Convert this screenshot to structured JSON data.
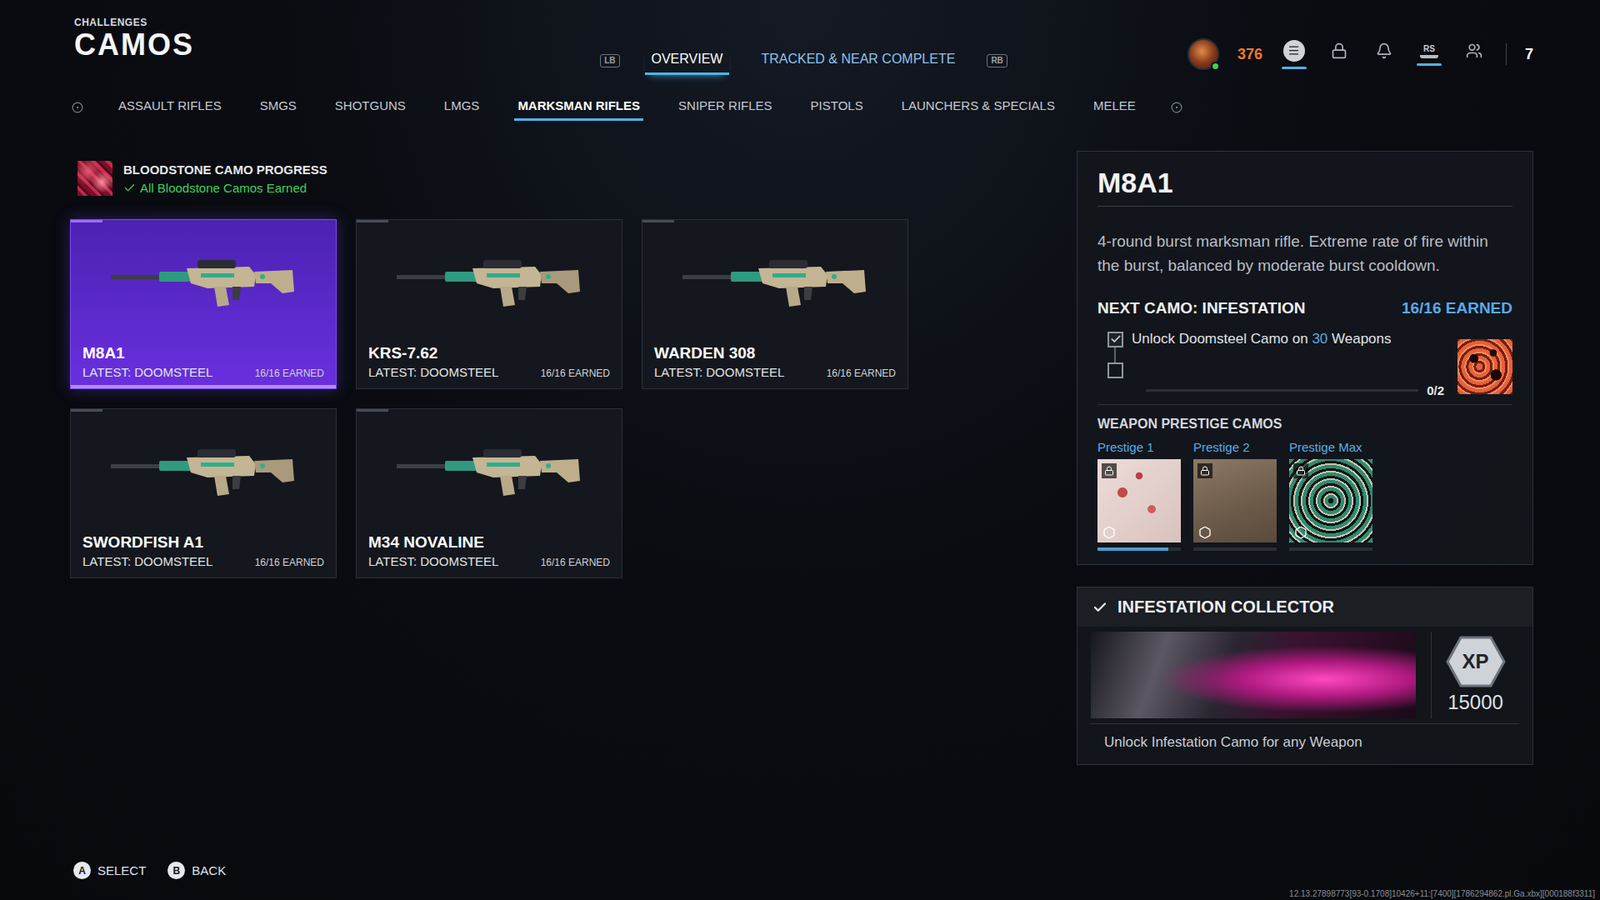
{
  "header": {
    "section": "CHALLENGES",
    "title": "CAMOS"
  },
  "nav": {
    "prev_key": "LB",
    "next_key": "RB",
    "tabs": [
      {
        "label": "OVERVIEW",
        "selected": true
      },
      {
        "label": "TRACKED & NEAR COMPLETE",
        "selected": false
      }
    ]
  },
  "status": {
    "currency": "376",
    "online": true,
    "icons": [
      {
        "kind": "menu",
        "label": "",
        "active": true
      },
      {
        "kind": "lock",
        "label": "",
        "active": false
      },
      {
        "kind": "bell",
        "label": "",
        "active": false
      },
      {
        "kind": "stick",
        "label": "RS",
        "active": true
      },
      {
        "kind": "party",
        "label": "",
        "active": false
      }
    ],
    "count": "7"
  },
  "categories": [
    {
      "label": "ASSAULT RIFLES",
      "selected": false
    },
    {
      "label": "SMGS",
      "selected": false
    },
    {
      "label": "SHOTGUNS",
      "selected": false
    },
    {
      "label": "LMGS",
      "selected": false
    },
    {
      "label": "MARKSMAN RIFLES",
      "selected": true
    },
    {
      "label": "SNIPER RIFLES",
      "selected": false
    },
    {
      "label": "PISTOLS",
      "selected": false
    },
    {
      "label": "LAUNCHERS & SPECIALS",
      "selected": false
    },
    {
      "label": "MELEE",
      "selected": false
    }
  ],
  "progress": {
    "title": "BLOODSTONE CAMO PROGRESS",
    "status": "All Bloodstone Camos Earned",
    "complete": true
  },
  "weapons": [
    {
      "name": "M8A1",
      "latest": "LATEST: DOOMSTEEL",
      "earned": "16/16 EARNED",
      "selected": true
    },
    {
      "name": "KRS-7.62",
      "latest": "LATEST: DOOMSTEEL",
      "earned": "16/16 EARNED",
      "selected": false
    },
    {
      "name": "WARDEN 308",
      "latest": "LATEST: DOOMSTEEL",
      "earned": "16/16 EARNED",
      "selected": false
    },
    {
      "name": "SWORDFISH A1",
      "latest": "LATEST: DOOMSTEEL",
      "earned": "16/16 EARNED",
      "selected": false
    },
    {
      "name": "M34 NOVALINE",
      "latest": "LATEST: DOOMSTEEL",
      "earned": "16/16 EARNED",
      "selected": false
    }
  ],
  "detail": {
    "name": "M8A1",
    "description": "4-round burst marksman rifle. Extreme rate of fire within the burst, balanced by moderate burst cooldown.",
    "next_camo": "NEXT CAMO: INFESTATION",
    "earned": "16/16 EARNED",
    "challenges": [
      {
        "text_before": "Unlock Doomsteel Camo on ",
        "count": "30",
        "text_after": " Weapons",
        "checked": true
      },
      {
        "text_before": "",
        "count": "",
        "text_after": "",
        "checked": false
      }
    ],
    "progress": {
      "reading": "0/2",
      "level": 0
    },
    "prestige_title": "WEAPON PRESTIGE CAMOS",
    "prestige": [
      {
        "label": "Prestige 1",
        "locked": true,
        "level": 0.85
      },
      {
        "label": "Prestige 2",
        "locked": true,
        "level": 0
      },
      {
        "label": "Prestige Max",
        "locked": true,
        "level": 0
      }
    ]
  },
  "collector": {
    "title": "INFESTATION COLLECTOR",
    "completed": true,
    "badge": "XP",
    "xp": "15000",
    "description": "Unlock Infestation Camo for any Weapon"
  },
  "hints": [
    {
      "key": "A",
      "label": "SELECT"
    },
    {
      "key": "B",
      "label": "BACK"
    }
  ],
  "build": "12.13.27898773[93-0.1708]10426+11:[7400][1786294862.pl.Ga.xbx][000188f3311]"
}
